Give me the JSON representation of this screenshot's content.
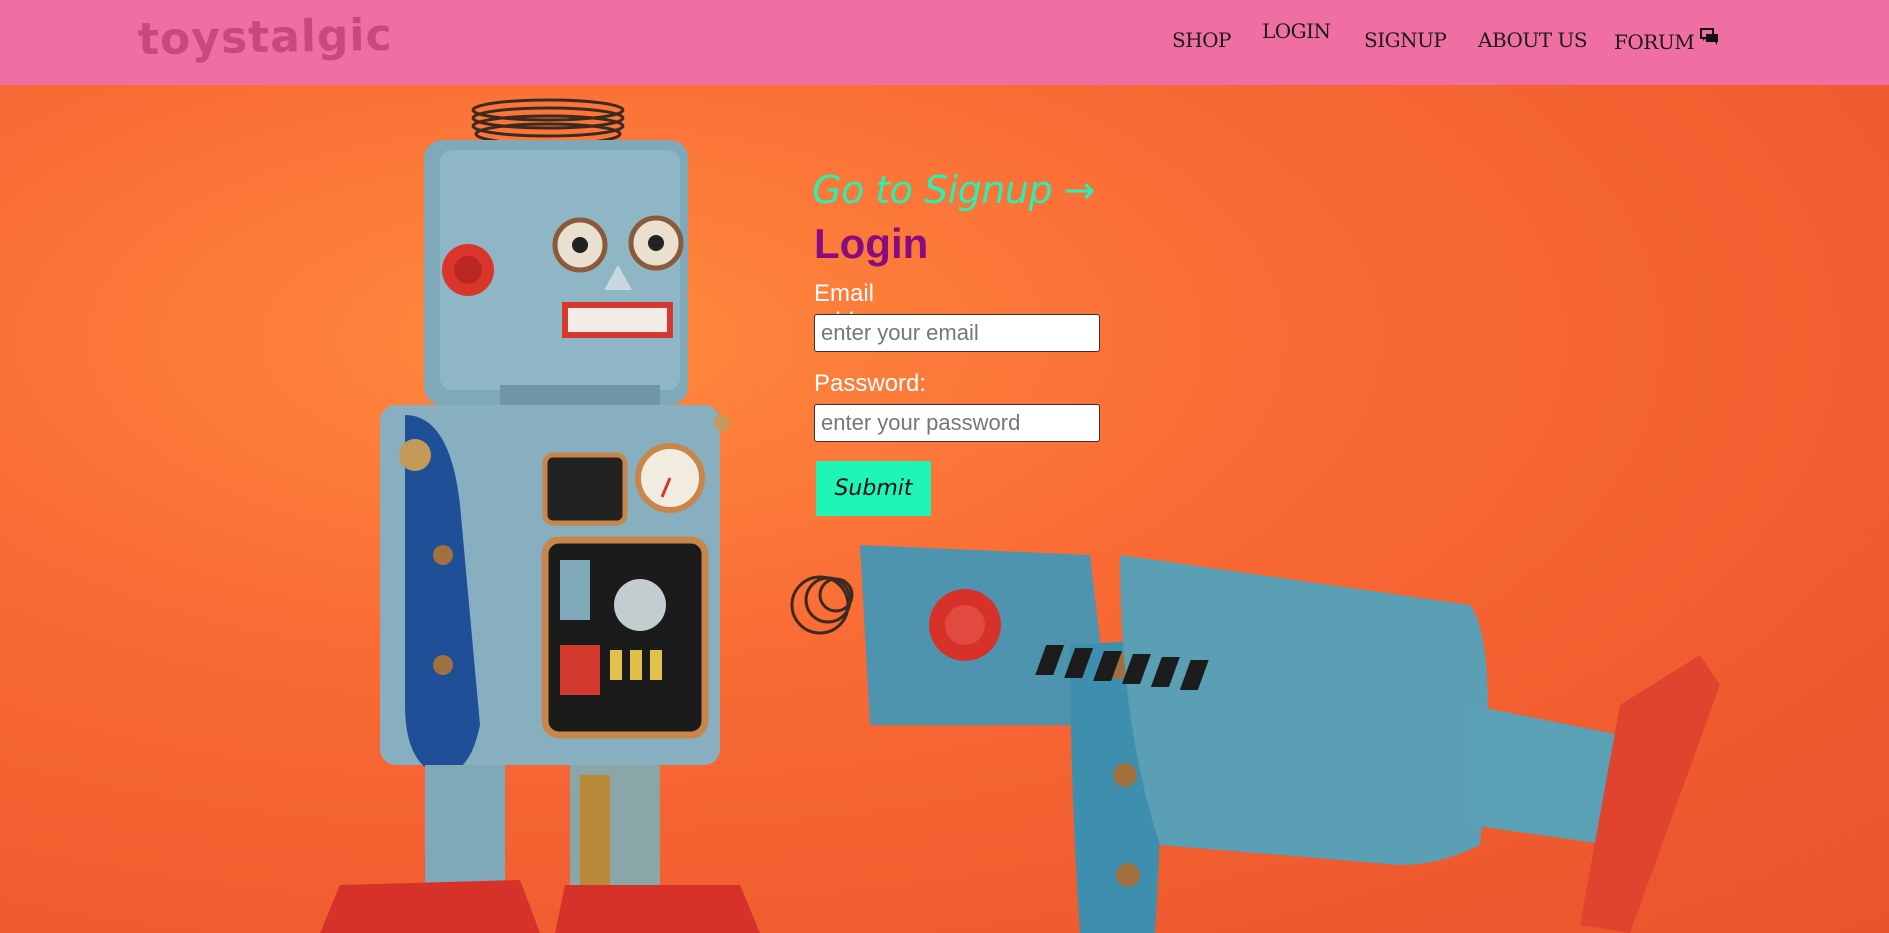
{
  "navbar": {
    "brand": "toystalgic",
    "links": [
      {
        "label": "SHOP"
      },
      {
        "label": "LOGIN"
      },
      {
        "label": "SIGNUP"
      },
      {
        "label": "ABOUT US"
      },
      {
        "label": "FORUM"
      }
    ],
    "forum_icon": "chat-bubbles-icon"
  },
  "form": {
    "signup_link": "Go to Signup →",
    "heading": "Login",
    "email_label": "Email address:",
    "email_placeholder": "enter your email",
    "email_value": "",
    "password_label": "Password:",
    "password_placeholder": "enter your password",
    "password_value": "",
    "submit_label": "Submit"
  },
  "colors": {
    "navbar_bg": "#ef6fa2",
    "brand": "#c7497e",
    "signup_link": "#2bf0b0",
    "heading": "#8a0b7e",
    "submit_bg": "#1ef5b7",
    "hero_bg": "#f2673a"
  }
}
